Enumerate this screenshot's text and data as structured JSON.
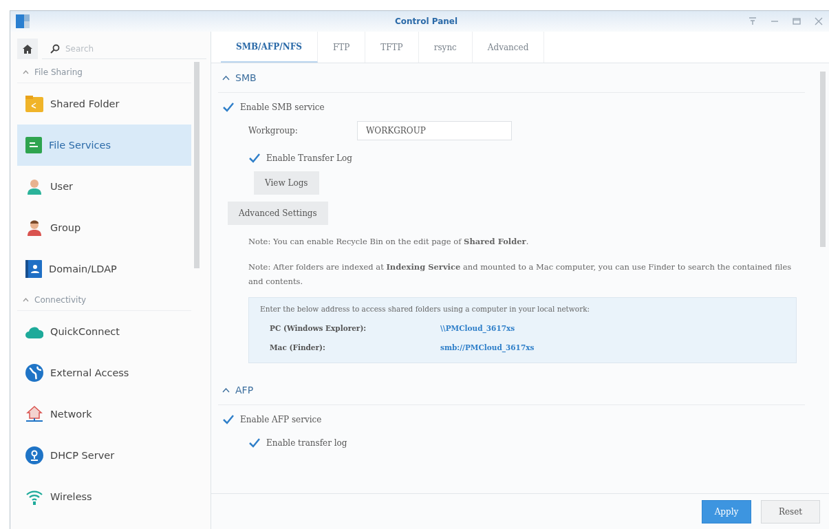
{
  "window": {
    "title": "Control Panel"
  },
  "sidebar": {
    "search": {
      "placeholder": "Search"
    },
    "sections": [
      {
        "title": "File Sharing",
        "expanded": true,
        "items": [
          {
            "label": "Shared Folder",
            "selected": false
          },
          {
            "label": "File Services",
            "selected": true
          },
          {
            "label": "User",
            "selected": false
          },
          {
            "label": "Group",
            "selected": false
          },
          {
            "label": "Domain/LDAP",
            "selected": false
          }
        ]
      },
      {
        "title": "Connectivity",
        "expanded": true,
        "items": [
          {
            "label": "QuickConnect",
            "selected": false
          },
          {
            "label": "External Access",
            "selected": false
          },
          {
            "label": "Network",
            "selected": false
          },
          {
            "label": "DHCP Server",
            "selected": false
          },
          {
            "label": "Wireless",
            "selected": false
          }
        ]
      }
    ]
  },
  "tabs": [
    {
      "label": "SMB/AFP/NFS",
      "selected": true
    },
    {
      "label": "FTP",
      "selected": false
    },
    {
      "label": "TFTP",
      "selected": false
    },
    {
      "label": "rsync",
      "selected": false
    },
    {
      "label": "Advanced",
      "selected": false
    }
  ],
  "sections": [
    {
      "title": "SMB",
      "expanded": true,
      "rows": [
        {
          "kind": "checkbox",
          "label": "Enable SMB service",
          "checked": true,
          "indent": false
        },
        {
          "kind": "field",
          "label": "Workgroup:",
          "value": "WORKGROUP"
        },
        {
          "kind": "checkbox",
          "label": "Enable Transfer Log",
          "checked": true,
          "indent": true
        },
        {
          "kind": "button",
          "label": "View Logs",
          "indent": true
        },
        {
          "kind": "button",
          "label": "Advanced Settings",
          "indent": false
        },
        {
          "kind": "note",
          "text": "Note: You can enable Recycle Bin on the edit page of **Shared Folder**."
        },
        {
          "kind": "note",
          "text": "Note: After folders are indexed at **Indexing Service** and mounted to a Mac computer, you can use Finder to search the contained files and contents."
        },
        {
          "kind": "address",
          "intro": "Enter the below address to access shared folders using a computer in your local network:",
          "entries": [
            {
              "label": "PC (Windows Explorer):",
              "value": "\\\\PMCloud_3617xs"
            },
            {
              "label": "Mac (Finder):",
              "value": "smb://PMCloud_3617xs"
            }
          ]
        }
      ]
    },
    {
      "title": "AFP",
      "expanded": true,
      "rows": [
        {
          "kind": "checkbox",
          "label": "Enable AFP service",
          "checked": true,
          "indent": false
        },
        {
          "kind": "checkbox",
          "label": "Enable transfer log",
          "checked": true,
          "indent": true
        }
      ]
    }
  ],
  "footer": {
    "buttons": [
      {
        "label": "Apply",
        "kind": "primary"
      },
      {
        "label": "Reset",
        "kind": "secondary"
      }
    ]
  }
}
